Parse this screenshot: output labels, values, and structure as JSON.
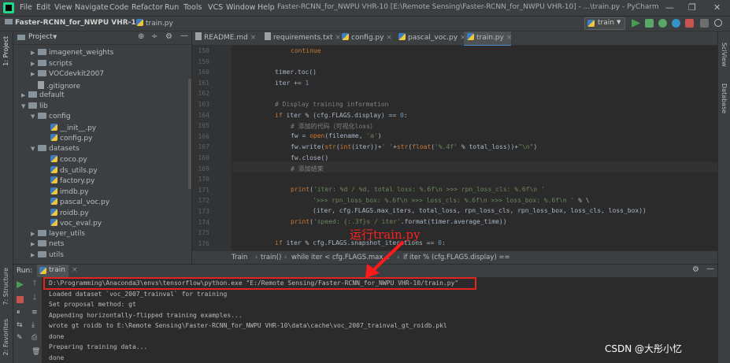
{
  "window": {
    "title": "Faster-RCNN_for_NWPU VHR-10 [E:\\Remote Sensing\\Faster-RCNN_for_NWPU VHR-10] - ...\\train.py - PyCharm",
    "menu": [
      "File",
      "Edit",
      "View",
      "Navigate",
      "Code",
      "Refactor",
      "Run",
      "Tools",
      "VCS",
      "Window",
      "Help"
    ],
    "controls": [
      "—",
      "❐",
      "✕"
    ]
  },
  "navbar": {
    "project": "Faster-RCNN_for_NWPU VHR-10",
    "file": "train.py",
    "run_config": "train"
  },
  "left_strip": {
    "project_tab": "1: Project",
    "structure_tab": "7: Structure",
    "favorites_tab": "2: Favorites"
  },
  "right_strip": {
    "sciview": "SciView",
    "database": "Database"
  },
  "project_panel": {
    "title": "Project",
    "tree": [
      {
        "label": "imagenet_weights",
        "type": "folder",
        "depth": 3,
        "arrow": "▶"
      },
      {
        "label": "scripts",
        "type": "folder",
        "depth": 3,
        "arrow": "▶"
      },
      {
        "label": "VOCdevkit2007",
        "type": "folder",
        "depth": 3,
        "arrow": "▶"
      },
      {
        "label": ".gitignore",
        "type": "file",
        "depth": 3,
        "arrow": ""
      },
      {
        "label": "default",
        "type": "folder",
        "depth": 2,
        "arrow": "▶"
      },
      {
        "label": "lib",
        "type": "folder",
        "depth": 2,
        "arrow": "▼"
      },
      {
        "label": "config",
        "type": "folder",
        "depth": 3,
        "arrow": "▼"
      },
      {
        "label": "__init__.py",
        "type": "py",
        "depth": 4,
        "arrow": ""
      },
      {
        "label": "config.py",
        "type": "py",
        "depth": 4,
        "arrow": ""
      },
      {
        "label": "datasets",
        "type": "folder",
        "depth": 3,
        "arrow": "▼"
      },
      {
        "label": "coco.py",
        "type": "py",
        "depth": 4,
        "arrow": ""
      },
      {
        "label": "ds_utils.py",
        "type": "py",
        "depth": 4,
        "arrow": ""
      },
      {
        "label": "factory.py",
        "type": "py",
        "depth": 4,
        "arrow": ""
      },
      {
        "label": "imdb.py",
        "type": "py",
        "depth": 4,
        "arrow": ""
      },
      {
        "label": "pascal_voc.py",
        "type": "py",
        "depth": 4,
        "arrow": ""
      },
      {
        "label": "roidb.py",
        "type": "py",
        "depth": 4,
        "arrow": ""
      },
      {
        "label": "voc_eval.py",
        "type": "py",
        "depth": 4,
        "arrow": ""
      },
      {
        "label": "layer_utils",
        "type": "folder",
        "depth": 3,
        "arrow": "▶"
      },
      {
        "label": "nets",
        "type": "folder",
        "depth": 3,
        "arrow": "▶"
      },
      {
        "label": "utils",
        "type": "folder",
        "depth": 3,
        "arrow": "▶"
      }
    ]
  },
  "editor": {
    "tabs": [
      {
        "label": "README.md"
      },
      {
        "label": "requirements.txt"
      },
      {
        "label": "config.py"
      },
      {
        "label": "pascal_voc.py"
      },
      {
        "label": "train.py",
        "active": true
      }
    ],
    "line_numbers": [
      "158",
      "159",
      "160",
      "161",
      "162",
      "163",
      "164",
      "165",
      "166",
      "167",
      "168",
      "169",
      "170",
      "171",
      "172",
      "173",
      "174",
      "175",
      "176"
    ],
    "breadcrumb": [
      "Train",
      "train()",
      "while iter < cfg.FLAGS.max...",
      "if iter % (cfg.FLAGS.display) =="
    ]
  },
  "run_panel": {
    "label": "Run:",
    "tab": "train",
    "lines": [
      "D:\\Programming\\Anaconda3\\envs\\tensorflow\\python.exe \"E:/Remote Sensing/Faster-RCNN_for_NWPU VHR-10/train.py\"",
      "Loaded dataset `voc_2007_trainval` for training",
      "Set proposal method: gt",
      "Appending horizontally-flipped training examples...",
      "wrote gt roidb to E:\\Remote Sensing\\Faster-RCNN_for_NWPU VHR-10\\data\\cache\\voc_2007_trainval_gt_roidb.pkl",
      "done",
      "Preparing training data...",
      "done"
    ]
  },
  "annotation": "运行train.py",
  "watermark": "CSDN @大彤小忆"
}
